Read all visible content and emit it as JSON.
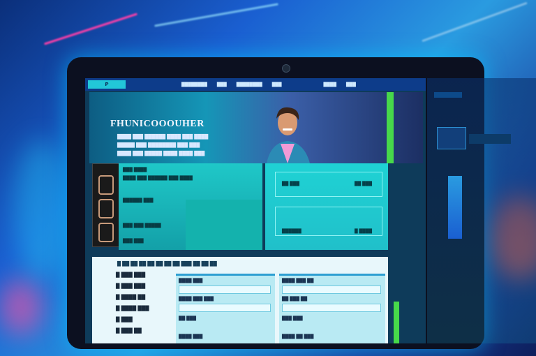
{
  "header": {
    "logo_text": "P",
    "nav_links": [
      "████████",
      "███",
      "████████",
      "███",
      "████",
      "███"
    ]
  },
  "hero": {
    "title": "FHUNICOOOUHER",
    "lines": [
      "████ ███ ██████ ████ ███ ████",
      "█████ ███ ████████ ███ ███",
      "████ ███ █████ ████ ████ ███"
    ]
  },
  "card1": {
    "rows": [
      "███ ████",
      "████ ███ ██████ ███ ████",
      "██████ ███",
      "███ ███ █████",
      "███ ███"
    ]
  },
  "card2": {
    "rows": [
      "██ ███",
      "██ ███",
      "██████",
      "█ ████"
    ]
  },
  "lower": {
    "header": "█ ██ ██ ██ ██ ██ ██ ██ ███ ██ ██ ██",
    "list": [
      "█ ███ ███",
      "█ ███ ███",
      "█ ████ ██",
      "█ ████ ███",
      "█ ███",
      "█ ███ ██"
    ],
    "form1": {
      "fields": [
        "████ ███",
        "████ ███ ███",
        "██ ███",
        "████ ███"
      ]
    },
    "form2": {
      "fields": [
        "████ ███ ██",
        "██ ███ ██",
        "███ ███",
        "████ ██ ███"
      ]
    }
  },
  "colors": {
    "accent": "#22c7d8",
    "bg_blue": "#1a5fd1",
    "green": "#47d84a"
  }
}
